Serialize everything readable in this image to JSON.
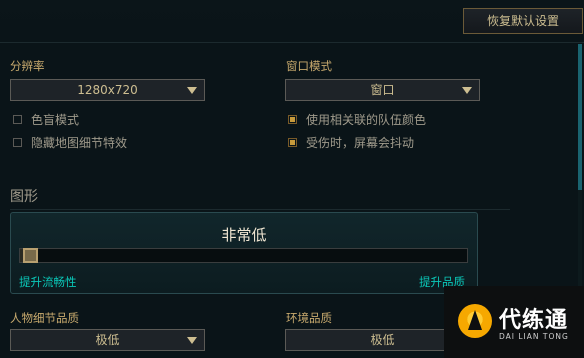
{
  "toolbar": {
    "reset_label": "恢复默认设置"
  },
  "resolution": {
    "label": "分辨率",
    "value": "1280x720"
  },
  "window_mode": {
    "label": "窗口模式",
    "value": "窗口"
  },
  "checkboxes": [
    {
      "label": "色盲模式",
      "checked": false
    },
    {
      "label": "隐藏地图细节特效",
      "checked": false
    },
    {
      "label": "使用相关联的队伍颜色",
      "checked": true
    },
    {
      "label": "受伤时，屏幕会抖动",
      "checked": true
    }
  ],
  "graphics": {
    "section_title": "图形",
    "quality_label": "非常低",
    "slider_value": 0,
    "left_label": "提升流畅性",
    "right_label": "提升品质"
  },
  "character_quality": {
    "label": "人物细节品质",
    "value": "极低"
  },
  "environment_quality": {
    "label": "环境品质",
    "value": "极低"
  },
  "watermark": {
    "name": "代练通",
    "sub": "DAI LIAN TONG"
  },
  "colors": {
    "accent_gold": "#c8aa6e",
    "teal": "#0ac8b9",
    "background": "#0a1418"
  }
}
